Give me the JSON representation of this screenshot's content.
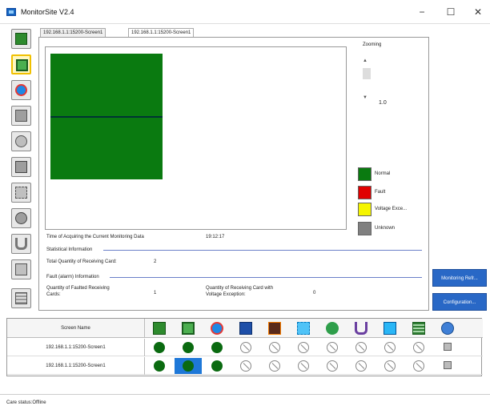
{
  "window": {
    "title": "MonitorSite V2.4",
    "minimize": "−",
    "maximize": "☐",
    "close": "✕"
  },
  "tabs": [
    "192.168.1.1:15200-Screen1",
    "192.168.1.1:15200-Screen1"
  ],
  "sidebar_icons": [
    "monitor-icon",
    "screen-icon",
    "temperature-icon",
    "receiving-card-icon",
    "disk-icon",
    "power-icon",
    "fan-icon",
    "voltage-icon",
    "magnet-icon",
    "door-icon",
    "module-icon"
  ],
  "zoom": {
    "label": "Zooming",
    "value": "1.0"
  },
  "legend": [
    {
      "label": "Normal",
      "color": "#0a7a10"
    },
    {
      "label": "Fault",
      "color": "#e00000"
    },
    {
      "label": "Voltage Exce...",
      "color": "#f5f500"
    },
    {
      "label": "Unknown",
      "color": "#808080"
    }
  ],
  "monitor_time": {
    "label": "Time of Acquiring the Current Monitoring Data",
    "value": "19:12:17"
  },
  "statistical": {
    "title": "Statistical Information",
    "total_label": "Total Quantity of Receiving Card:",
    "total_value": "2"
  },
  "fault": {
    "title": "Fault (alarm) Information",
    "faulted_label_1": "Quantity of Faulted Receiving",
    "faulted_label_2": "Cards:",
    "faulted_value": "1",
    "voltage_label_1": "Quantity of Receiving Card with",
    "voltage_label_2": "Voltage Exception:",
    "voltage_value": "0"
  },
  "buttons": {
    "monitoring": "Monitoring Refr...",
    "configuration": "Configuration..."
  },
  "grid": {
    "header": "Screen Name",
    "header_icons": [
      "monitor-icon",
      "screen-icon",
      "temperature-icon",
      "receiving-card-icon",
      "power-icon",
      "fan-icon",
      "voltage-icon",
      "magnet-icon",
      "door-icon",
      "module-icon",
      "globe-icon"
    ],
    "rows": [
      {
        "name": "192.168.1.1:15200-Screen1",
        "cells": [
          "ok",
          "ok",
          "ok",
          "na",
          "na",
          "na",
          "na",
          "na",
          "na",
          "na",
          "mini"
        ]
      },
      {
        "name": "192.168.1.1:15200-Screen1",
        "cells": [
          "ok",
          "selected",
          "ok",
          "na",
          "na",
          "na",
          "na",
          "na",
          "na",
          "na",
          "mini"
        ]
      }
    ]
  },
  "status": {
    "text": "Care status:Offline"
  }
}
